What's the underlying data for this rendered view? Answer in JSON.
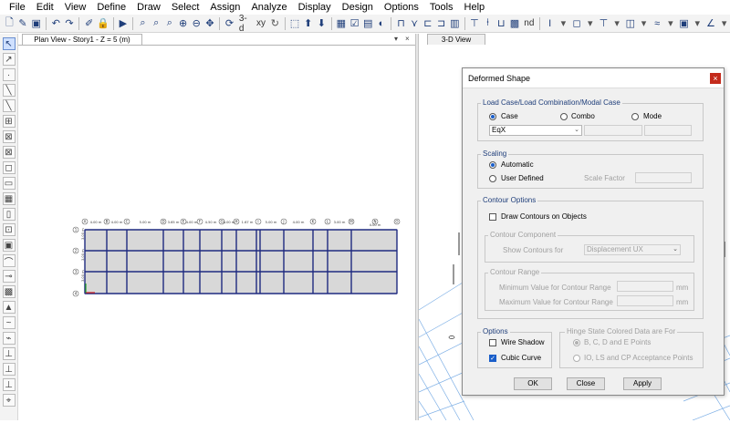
{
  "menu": [
    "File",
    "Edit",
    "View",
    "Define",
    "Draw",
    "Select",
    "Assign",
    "Analyze",
    "Display",
    "Design",
    "Options",
    "Tools",
    "Help"
  ],
  "toolbar": {
    "three_d_label": "3-d",
    "xy_label": "xy",
    "nd_label": "nd"
  },
  "plan_view": {
    "tab_label": "Plan View - Story1 - Z = 5 (m)",
    "pin_glyph": "▾",
    "close_glyph": "×",
    "grid_labels_top": [
      "A",
      "B",
      "C",
      "D",
      "E",
      "F",
      "G",
      "H",
      "I",
      "J",
      "K",
      "L",
      "M",
      "N",
      "O"
    ],
    "dims_top": [
      "4.00 m",
      "4.00 m",
      "5.00 m",
      "3.65 m",
      "4.00 m",
      "4.50 m",
      "4.00 m",
      "1.67 m",
      "5.00 m",
      "4.00 m",
      "3.00 m",
      "4.00 m"
    ],
    "grid_labels_left": [
      "1",
      "2",
      "3",
      "4"
    ],
    "dims_left": [
      "3.00 m",
      "3.00 m",
      "3.00 m"
    ]
  },
  "view3d": {
    "tab_label": "3-D View"
  },
  "dialog": {
    "title": "Deformed Shape",
    "close_glyph": "×",
    "load_case": {
      "group_title": "Load Case/Load Combination/Modal Case",
      "radio_case": "Case",
      "radio_combo": "Combo",
      "radio_mode": "Mode",
      "selected_case": "EqX"
    },
    "scaling": {
      "group_title": "Scaling",
      "radio_automatic": "Automatic",
      "radio_user_defined": "User Defined",
      "scale_factor_label": "Scale Factor"
    },
    "contour": {
      "group_title": "Contour Options",
      "draw_contours_label": "Draw Contours on Objects",
      "component_title": "Contour Component",
      "show_contours_for_label": "Show Contours for",
      "show_contours_for_value": "Displacement UX",
      "range_title": "Contour Range",
      "min_label": "Minimum Value for Contour Range",
      "max_label": "Maximum Value for Contour Range",
      "unit": "mm"
    },
    "options": {
      "group_title": "Options",
      "wire_shadow_label": "Wire Shadow",
      "cubic_curve_label": "Cubic Curve"
    },
    "hinge": {
      "group_title": "Hinge State Colored Data are For",
      "radio_bcde": "B, C, D and E Points",
      "radio_io": "IO, LS and CP Acceptance Points"
    },
    "buttons": {
      "ok": "OK",
      "close": "Close",
      "apply": "Apply"
    }
  },
  "colors": {
    "accent": "#1a5ec9",
    "frame": "#1f2a80",
    "slab": "#d8d8d8",
    "close_red": "#c42b1c"
  }
}
